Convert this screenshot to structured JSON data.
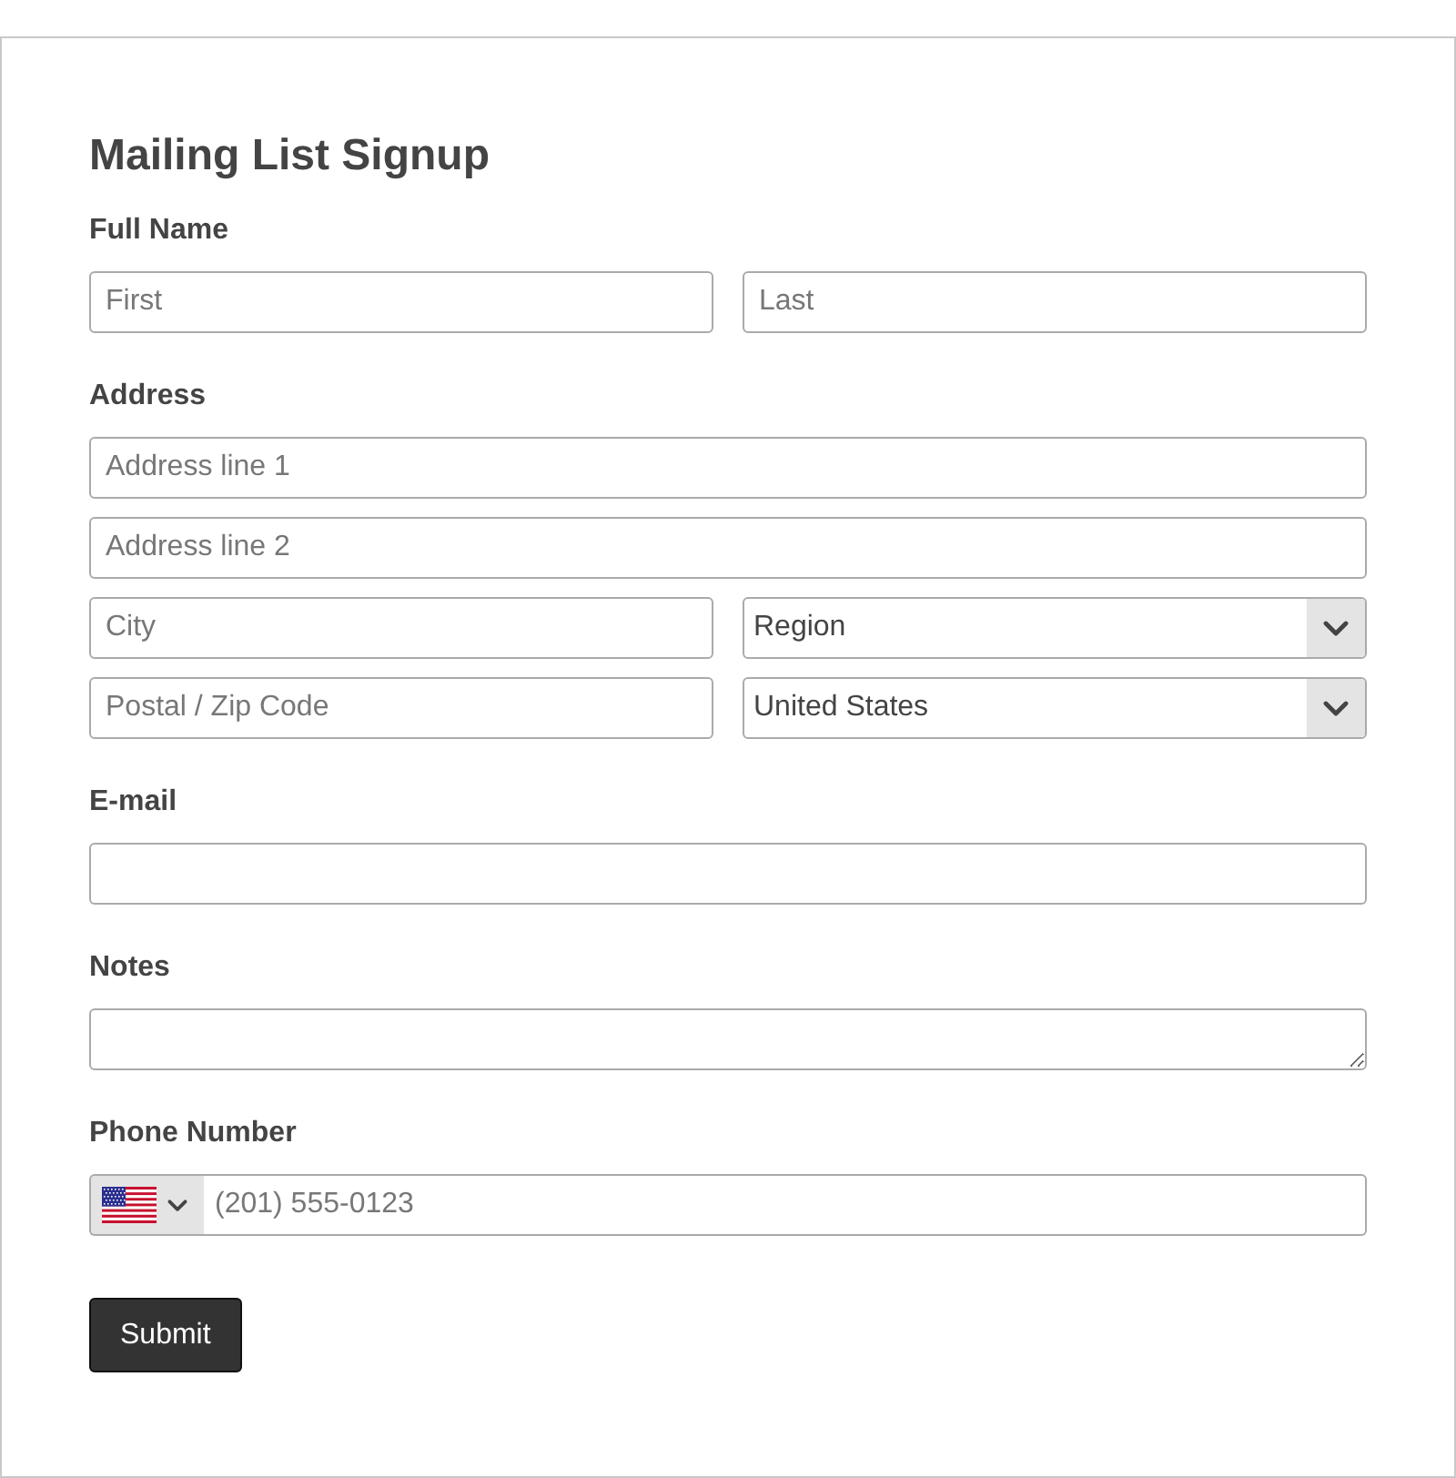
{
  "title": "Mailing List Signup",
  "sections": [
    {
      "label": "Full Name",
      "rows": [
        [
          {
            "kind": "text",
            "placeholder": "First"
          },
          {
            "kind": "text",
            "placeholder": "Last"
          }
        ]
      ]
    },
    {
      "label": "Address",
      "rows": [
        [
          {
            "kind": "text",
            "placeholder": "Address line 1"
          }
        ],
        [
          {
            "kind": "text",
            "placeholder": "Address line 2"
          }
        ],
        [
          {
            "kind": "text",
            "placeholder": "City"
          },
          {
            "kind": "select",
            "value": "Region"
          }
        ],
        [
          {
            "kind": "text",
            "placeholder": "Postal / Zip Code"
          },
          {
            "kind": "select",
            "value": "United States"
          }
        ]
      ]
    },
    {
      "label": "E-mail",
      "rows": [
        [
          {
            "kind": "text"
          }
        ]
      ]
    },
    {
      "label": "Notes",
      "rows": [
        [
          {
            "kind": "textarea"
          }
        ]
      ]
    },
    {
      "label": "Phone Number",
      "rows": [
        [
          {
            "kind": "phone",
            "placeholder": "(201) 555-0123"
          }
        ]
      ]
    }
  ],
  "submit": {
    "label": "Submit"
  }
}
